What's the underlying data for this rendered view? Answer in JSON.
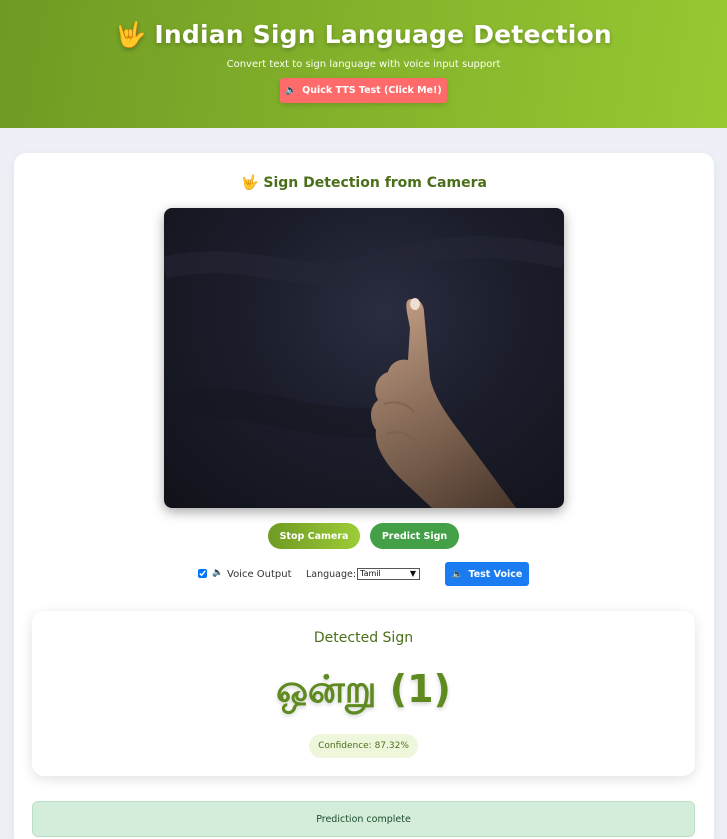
{
  "header": {
    "icon": "hand-sign-icon",
    "title": "Indian Sign Language Detection",
    "subtitle": "Convert text to sign language with voice input support",
    "tts_button_label": "Quick TTS Test (Click Me!)"
  },
  "camera_section": {
    "icon": "hand-sign-icon",
    "title": "Sign Detection from Camera",
    "stop_button_label": "Stop Camera",
    "predict_button_label": "Predict Sign"
  },
  "controls": {
    "voice_output_label": "Voice Output",
    "voice_output_checked": true,
    "language_label": "Language:",
    "language_selected": "Tamil",
    "test_voice_label": "Test Voice"
  },
  "result": {
    "label": "Detected Sign",
    "value": "ஒன்று (1)",
    "confidence": "Confidence: 87.32%"
  },
  "status": {
    "message": "Prediction complete"
  },
  "colors": {
    "header_gradient_start": "#6f9a24",
    "header_gradient_end": "#97c932",
    "tts_button": "#ff6b6b",
    "predict_button": "#43a047",
    "test_voice_button": "#1a7cf0",
    "accent_text": "#5e8a1f",
    "status_background": "#d4edda"
  }
}
